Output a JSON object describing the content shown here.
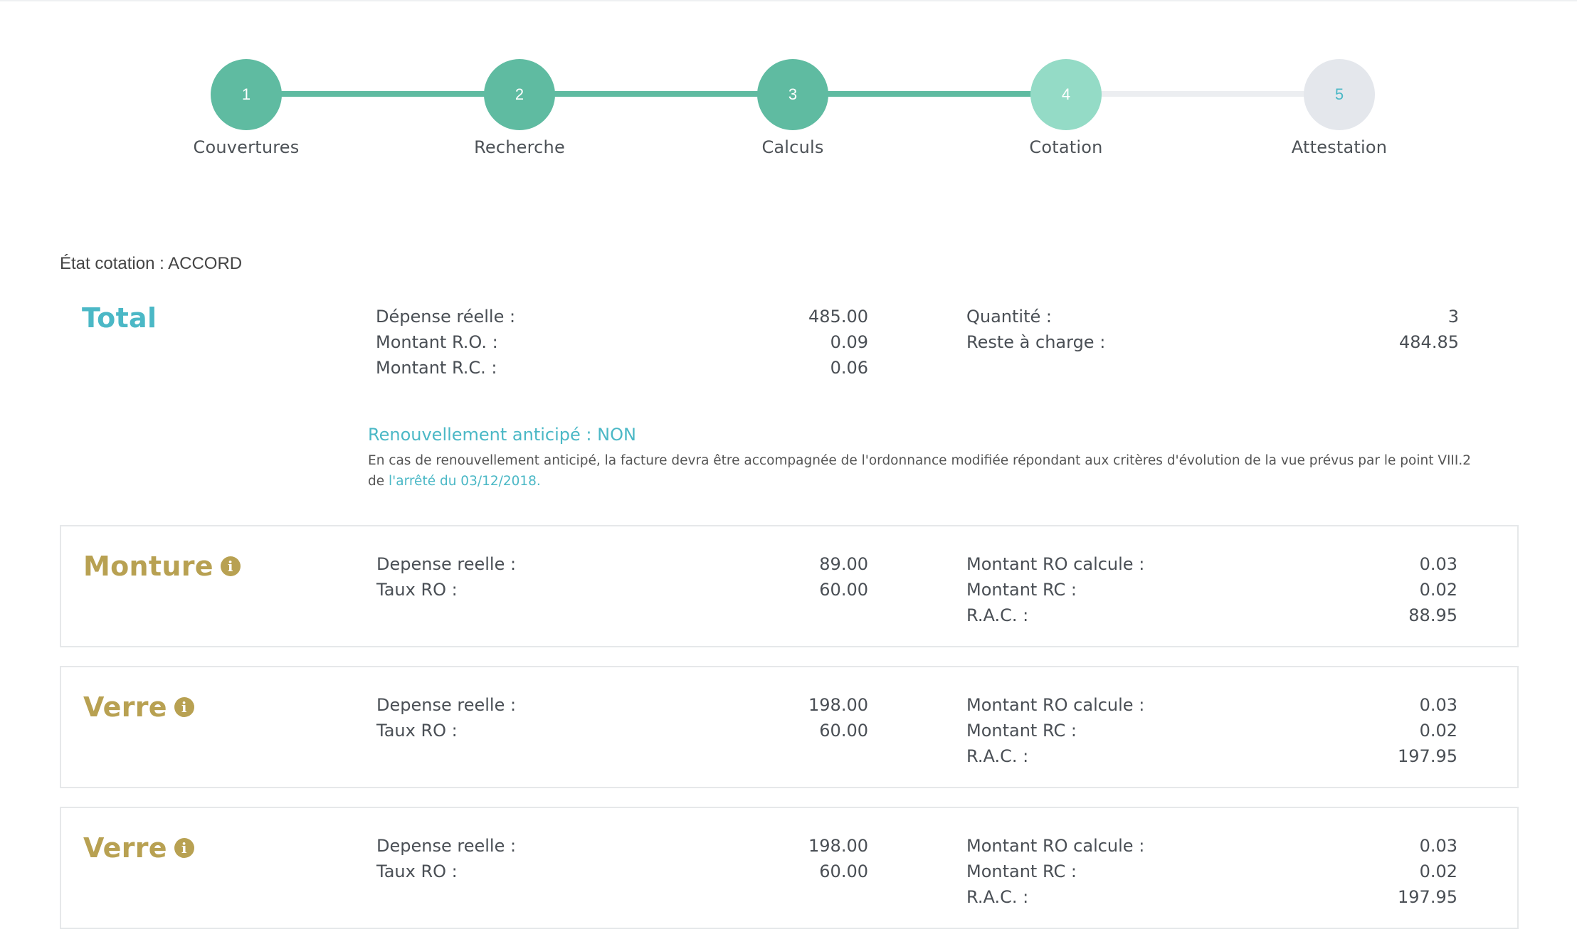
{
  "stepper": {
    "steps": [
      {
        "number": "1",
        "label": "Couvertures",
        "state": "done"
      },
      {
        "number": "2",
        "label": "Recherche",
        "state": "done"
      },
      {
        "number": "3",
        "label": "Calculs",
        "state": "done"
      },
      {
        "number": "4",
        "label": "Cotation",
        "state": "active"
      },
      {
        "number": "5",
        "label": "Attestation",
        "state": "pending"
      }
    ],
    "colors": {
      "done": "#5fbba1",
      "active": "#94dbc6",
      "pending": "#e4e7ec",
      "pending_text": "#4bb8c6",
      "line_done": "#5fbba1",
      "line_pending": "#eceef1"
    }
  },
  "etat": "État cotation : ACCORD",
  "total": {
    "title": "Total",
    "depense_label": "Dépense réelle :",
    "depense_value": "485.00",
    "ro_label": "Montant R.O. :",
    "ro_value": "0.09",
    "rc_label": "Montant R.C. :",
    "rc_value": "0.06",
    "quantite_label": "Quantité :",
    "quantite_value": "3",
    "reste_label": "Reste à charge :",
    "reste_value": "484.85"
  },
  "renouvellement": {
    "title": "Renouvellement anticipé : NON",
    "text": "En cas de renouvellement anticipé, la facture devra être accompagnée de l'ordonnance modifiée répondant aux critères d'évolution de la vue prévus par le point VIII.2",
    "text2_prefix": "de ",
    "link": "l'arrêté du 03/12/2018.",
    "icon": "info-icon"
  },
  "items": [
    {
      "title": "Monture",
      "depense_label": "Depense reelle :",
      "depense_value": "89.00",
      "taux_label": "Taux RO :",
      "taux_value": "60.00",
      "ro_label": "Montant RO calcule :",
      "ro_value": "0.03",
      "rc_label": "Montant RC :",
      "rc_value": "0.02",
      "rac_label": "R.A.C. :",
      "rac_value": "88.95"
    },
    {
      "title": "Verre",
      "depense_label": "Depense reelle :",
      "depense_value": "198.00",
      "taux_label": "Taux RO :",
      "taux_value": "60.00",
      "ro_label": "Montant RO calcule :",
      "ro_value": "0.03",
      "rc_label": "Montant RC :",
      "rc_value": "0.02",
      "rac_label": "R.A.C. :",
      "rac_value": "197.95"
    },
    {
      "title": "Verre",
      "depense_label": "Depense reelle :",
      "depense_value": "198.00",
      "taux_label": "Taux RO :",
      "taux_value": "60.00",
      "ro_label": "Montant RO calcule :",
      "ro_value": "0.03",
      "rc_label": "Montant RC :",
      "rc_value": "0.02",
      "rac_label": "R.A.C. :",
      "rac_value": "197.95"
    }
  ]
}
